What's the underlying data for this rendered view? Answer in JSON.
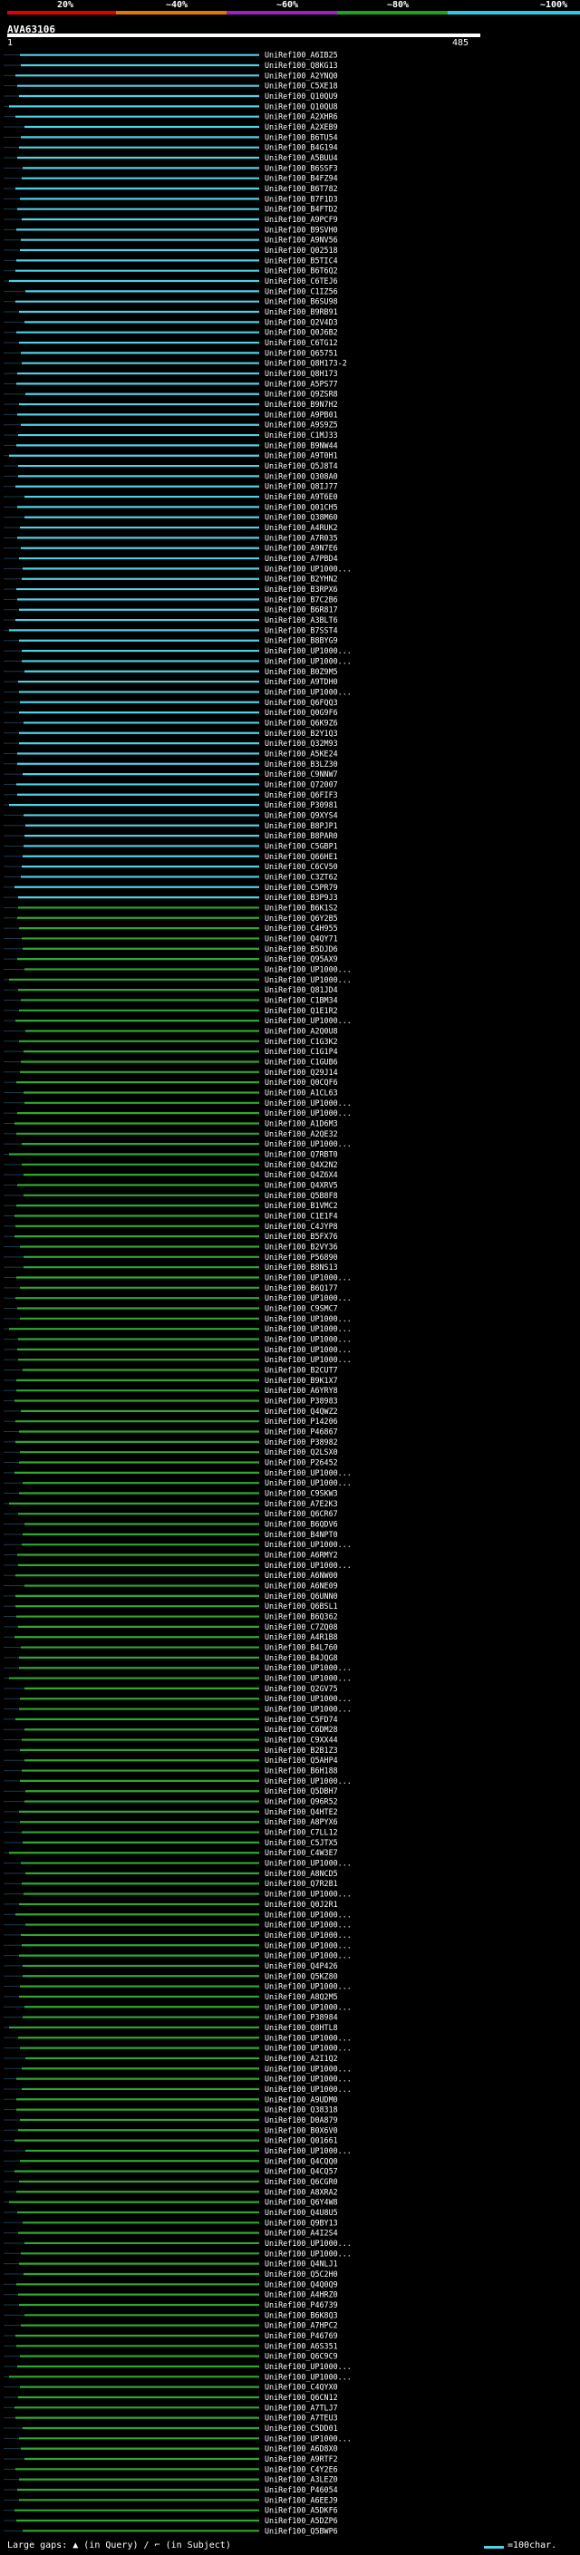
{
  "scale": {
    "ticks": [
      "20%",
      "~40%",
      "~60%",
      "~80%",
      "~100%"
    ],
    "colors": [
      "#e00000",
      "#e07a00",
      "#a020c0",
      "#22a022",
      "#30c8e0"
    ]
  },
  "query": {
    "id": "AVA63106",
    "start": "1",
    "end": "485"
  },
  "colors": {
    "cyan": "#4fd1e6",
    "green": "#2ea82e",
    "bg": "#000000"
  },
  "hits": [
    "UniRef100_A6IB25",
    "UniRef100_Q8KG13",
    "UniRef100_A2YNQ0",
    "UniRef100_C5XE18",
    "UniRef100_Q10QU9",
    "UniRef100_Q10QU8",
    "UniRef100_A2XHR6",
    "UniRef100_A2XEB9",
    "UniRef100_B6TU54",
    "UniRef100_B4G194",
    "UniRef100_A5BUU4",
    "UniRef100_B6SSF3",
    "UniRef100_B4FZ94",
    "UniRef100_B6T782",
    "UniRef100_B7F1D3",
    "UniRef100_B4FTD2",
    "UniRef100_A9PCF9",
    "UniRef100_B9SVH0",
    "UniRef100_A9NV56",
    "UniRef100_Q02518",
    "UniRef100_B5TIC4",
    "UniRef100_B6T6Q2",
    "UniRef100_C6TEJ6",
    "UniRef100_C1IZ56",
    "UniRef100_B6SU98",
    "UniRef100_B9RB91",
    "UniRef100_Q2V4D3",
    "UniRef100_Q0J6B2",
    "UniRef100_C6TG12",
    "UniRef100_Q65751",
    "UniRef100_Q8H173-2",
    "UniRef100_Q8H173",
    "UniRef100_A5PS77",
    "UniRef100_Q9ZSR8",
    "UniRef100_B9N7H2",
    "UniRef100_A9PB01",
    "UniRef100_A9S9Z5",
    "UniRef100_C1MJ33",
    "UniRef100_B9NW44",
    "UniRef100_A9T0H1",
    "UniRef100_Q5J8T4",
    "UniRef100_Q308A0",
    "UniRef100_Q8IJ77",
    "UniRef100_A9T6E0",
    "UniRef100_Q01CH5",
    "UniRef100_Q38M60",
    "UniRef100_A4RUK2",
    "UniRef100_A7R035",
    "UniRef100_A9N7E6",
    "UniRef100_A7PBD4",
    "UniRef100_UP1000...",
    "UniRef100_B2YHN2",
    "UniRef100_B3RPX6",
    "UniRef100_B7C2B6",
    "UniRef100_B6R817",
    "UniRef100_A3BLT6",
    "UniRef100_B7SST4",
    "UniRef100_B8BYG9",
    "UniRef100_UP1000...",
    "UniRef100_UP1000...",
    "UniRef100_B0Z9M5",
    "UniRef100_A9TDH0",
    "UniRef100_UP1000...",
    "UniRef100_Q6FQQ3",
    "UniRef100_Q0G9F6",
    "UniRef100_Q6K9Z6",
    "UniRef100_B2Y1Q3",
    "UniRef100_Q32M93",
    "UniRef100_A5KE24",
    "UniRef100_B3LZ30",
    "UniRef100_C9NNW7",
    "UniRef100_Q72007",
    "UniRef100_Q6FIF3",
    "UniRef100_P30981",
    "UniRef100_Q9XYS4",
    "UniRef100_B8PJP1",
    "UniRef100_B8PAR0",
    "UniRef100_C5GBP1",
    "UniRef100_Q66HE1",
    "UniRef100_C6CV50",
    "UniRef100_C3ZT62",
    "UniRef100_C5PR79",
    "UniRef100_B3P9J3",
    "UniRef100_B6K1S2",
    "UniRef100_Q6Y2B5",
    "UniRef100_C4H955",
    "UniRef100_Q4QY71",
    "UniRef100_B5DJD6",
    "UniRef100_Q95AX9",
    "UniRef100_UP1000...",
    "UniRef100_UP1000...",
    "UniRef100_Q81JD4",
    "UniRef100_C1BM34",
    "UniRef100_Q1E1R2",
    "UniRef100_UP1000...",
    "UniRef100_A2Q0U8",
    "UniRef100_C1G3K2",
    "UniRef100_C1G1P4",
    "UniRef100_C1GUB6",
    "UniRef100_Q29J14",
    "UniRef100_Q0CQF6",
    "UniRef100_A1CL63",
    "UniRef100_UP1000...",
    "UniRef100_UP1000...",
    "UniRef100_A1D6M3",
    "UniRef100_A2QE32",
    "UniRef100_UP1000...",
    "UniRef100_Q7RBT0",
    "UniRef100_Q4X2N2",
    "UniRef100_Q4Z6X4",
    "UniRef100_Q4XRV5",
    "UniRef100_Q5B8F8",
    "UniRef100_B1VMC2",
    "UniRef100_C1E1F4",
    "UniRef100_C4JYP8",
    "UniRef100_B5FX76",
    "UniRef100_B2VY36",
    "UniRef100_P56890",
    "UniRef100_B8NS13",
    "UniRef100_UP1000...",
    "UniRef100_B6Q177",
    "UniRef100_UP1000...",
    "UniRef100_C9SMC7",
    "UniRef100_UP1000...",
    "UniRef100_UP1000...",
    "UniRef100_UP1000...",
    "UniRef100_UP1000...",
    "UniRef100_UP1000...",
    "UniRef100_B2CUT7",
    "UniRef100_B9K1X7",
    "UniRef100_A6YRY8",
    "UniRef100_P38983",
    "UniRef100_Q4QWZ2",
    "UniRef100_P14206",
    "UniRef100_P46867",
    "UniRef100_P38982",
    "UniRef100_Q2LSX0",
    "UniRef100_P26452",
    "UniRef100_UP1000...",
    "UniRef100_UP1000...",
    "UniRef100_C9SKW3",
    "UniRef100_A7E2K3",
    "UniRef100_Q6CR67",
    "UniRef100_B6QDV6",
    "UniRef100_B4NPT0",
    "UniRef100_UP1000...",
    "UniRef100_A6RMY2",
    "UniRef100_UP1000...",
    "UniRef100_A6NW00",
    "UniRef100_A6NE09",
    "UniRef100_Q6UNN0",
    "UniRef100_Q6BSL1",
    "UniRef100_B6Q362",
    "UniRef100_C7ZQ08",
    "UniRef100_A4R1B8",
    "UniRef100_B4L760",
    "UniRef100_B4JQG8",
    "UniRef100_UP1000...",
    "UniRef100_UP1000...",
    "UniRef100_Q2GV75",
    "UniRef100_UP1000...",
    "UniRef100_UP1000...",
    "UniRef100_C5FD74",
    "UniRef100_C6DM28",
    "UniRef100_C9XX44",
    "UniRef100_B2B1Z3",
    "UniRef100_Q5AHP4",
    "UniRef100_B6H188",
    "UniRef100_UP1000...",
    "UniRef100_Q5DBH7",
    "UniRef100_Q96R52",
    "UniRef100_Q4HTE2",
    "UniRef100_A8PYX6",
    "UniRef100_C7LL12",
    "UniRef100_C5JTX5",
    "UniRef100_C4W3E7",
    "UniRef100_UP1000...",
    "UniRef100_A8NCD5",
    "UniRef100_Q7R2B1",
    "UniRef100_UP1000...",
    "UniRef100_Q0J2R1",
    "UniRef100_UP1000...",
    "UniRef100_UP1000...",
    "UniRef100_UP1000...",
    "UniRef100_UP1000...",
    "UniRef100_UP1000...",
    "UniRef100_Q4P426",
    "UniRef100_Q5KZ80",
    "UniRef100_UP1000...",
    "UniRef100_A8Q2M5",
    "UniRef100_UP1000...",
    "UniRef100_P38984",
    "UniRef100_Q8HTL8",
    "UniRef100_UP1000...",
    "UniRef100_UP1000...",
    "UniRef100_A2I1Q2",
    "UniRef100_UP1000...",
    "UniRef100_UP1000...",
    "UniRef100_UP1000...",
    "UniRef100_A9UDM0",
    "UniRef100_Q38318",
    "UniRef100_D0A879",
    "UniRef100_B0X6V0",
    "UniRef100_Q01661",
    "UniRef100_UP1000...",
    "UniRef100_Q4CQQ0",
    "UniRef100_Q4CQ57",
    "UniRef100_Q6CGR0",
    "UniRef100_A8XRA2",
    "UniRef100_Q6Y4W8",
    "UniRef100_Q4U8U5",
    "UniRef100_Q9BY13",
    "UniRef100_A4I2S4",
    "UniRef100_UP1000...",
    "UniRef100_UP1000...",
    "UniRef100_Q4NLJ1",
    "UniRef100_Q5C2H0",
    "UniRef100_Q4Q0Q9",
    "UniRef100_A4HRZ0",
    "UniRef100_P46739",
    "UniRef100_B6K8Q3",
    "UniRef100_A7HPC2",
    "UniRef100_P46769",
    "UniRef100_A6S351",
    "UniRef100_Q6C9C9",
    "UniRef100_UP1000...",
    "UniRef100_UP1000...",
    "UniRef100_C4QYX0",
    "UniRef100_Q6CN12",
    "UniRef100_A7TLJ7",
    "UniRef100_A7TEU3",
    "UniRef100_C5DD01",
    "UniRef100_UP1000...",
    "UniRef100_A6D8X0",
    "UniRef100_A9RTF2",
    "UniRef100_C4Y2E6",
    "UniRef100_A3LEZ0",
    "UniRef100_P46054",
    "UniRef100_A6EEJ9",
    "UniRef100_A5DKF6",
    "UniRef100_A5DZP6",
    "UniRef100_Q5BWP6"
  ],
  "legend": {
    "left_text": "Large gaps: ▲ (in Query) / ⌐ (in Subject)",
    "right_text": "=100char."
  }
}
